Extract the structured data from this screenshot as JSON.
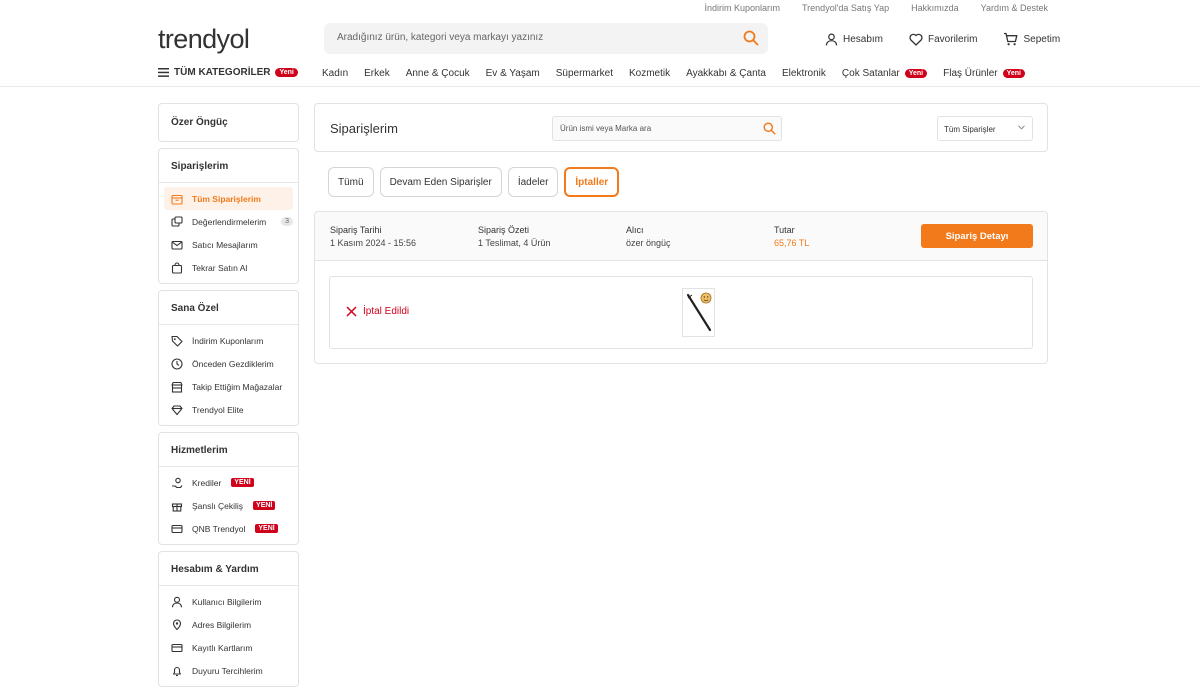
{
  "top_links": [
    "İndirim Kuponlarım",
    "Trendyol'da Satış Yap",
    "Hakkımızda",
    "Yardım & Destek"
  ],
  "logo": "trendyol",
  "search": {
    "placeholder": "Aradığınız ürün, kategori veya markayı yazınız"
  },
  "user_actions": {
    "account": "Hesabım",
    "favorites": "Favorilerim",
    "cart": "Sepetim"
  },
  "category_nav": {
    "all_label": "TÜM KATEGORİLER",
    "all_badge": "Yeni",
    "items": [
      "Kadın",
      "Erkek",
      "Anne & Çocuk",
      "Ev & Yaşam",
      "Süpermarket",
      "Kozmetik",
      "Ayakkabı & Çanta",
      "Elektronik",
      "Çok Satanlar",
      "Flaş Ürünler"
    ],
    "item_badge": "Yeni"
  },
  "sidebar": {
    "user_name": "Özer Öngüç",
    "orders": {
      "title": "Siparişlerim",
      "items": [
        "Tüm Siparişlerim",
        "Değerlendirmelerim",
        "Satıcı Mesajlarım",
        "Tekrar Satın Al"
      ],
      "review_count": "3"
    },
    "special": {
      "title": "Sana Özel",
      "items": [
        "İndirim Kuponlarım",
        "Önceden Gezdiklerim",
        "Takip Ettiğim Mağazalar",
        "Trendyol Elite"
      ]
    },
    "services": {
      "title": "Hizmetlerim",
      "items": [
        "Krediler",
        "Şanslı Çekiliş",
        "QNB Trendyol"
      ],
      "badge": "YENİ"
    },
    "account": {
      "title": "Hesabım & Yardım",
      "items": [
        "Kullanıcı Bilgilerim",
        "Adres Bilgilerim",
        "Kayıtlı Kartlarım",
        "Duyuru Tercihlerim"
      ]
    }
  },
  "main": {
    "title": "Siparişlerim",
    "search_placeholder": "Ürün ismi veya Marka ara",
    "filter_select": "Tüm Siparişler",
    "tabs": [
      "Tümü",
      "Devam Eden Siparişler",
      "İadeler",
      "İptaller"
    ],
    "order": {
      "date_label": "Sipariş Tarihi",
      "date_value": "1 Kasım 2024 - 15:56",
      "summary_label": "Sipariş Özeti",
      "summary_value": "1 Teslimat, 4 Ürün",
      "recipient_label": "Alıcı",
      "recipient_value": "özer öngüç",
      "total_label": "Tutar",
      "total_value": "65,76 TL",
      "detail_button": "Sipariş Detayı",
      "status": "İptal Edildi"
    }
  },
  "colors": {
    "brand": "#f27a1a",
    "badge": "#d0021b",
    "cancel": "#d0021b"
  }
}
